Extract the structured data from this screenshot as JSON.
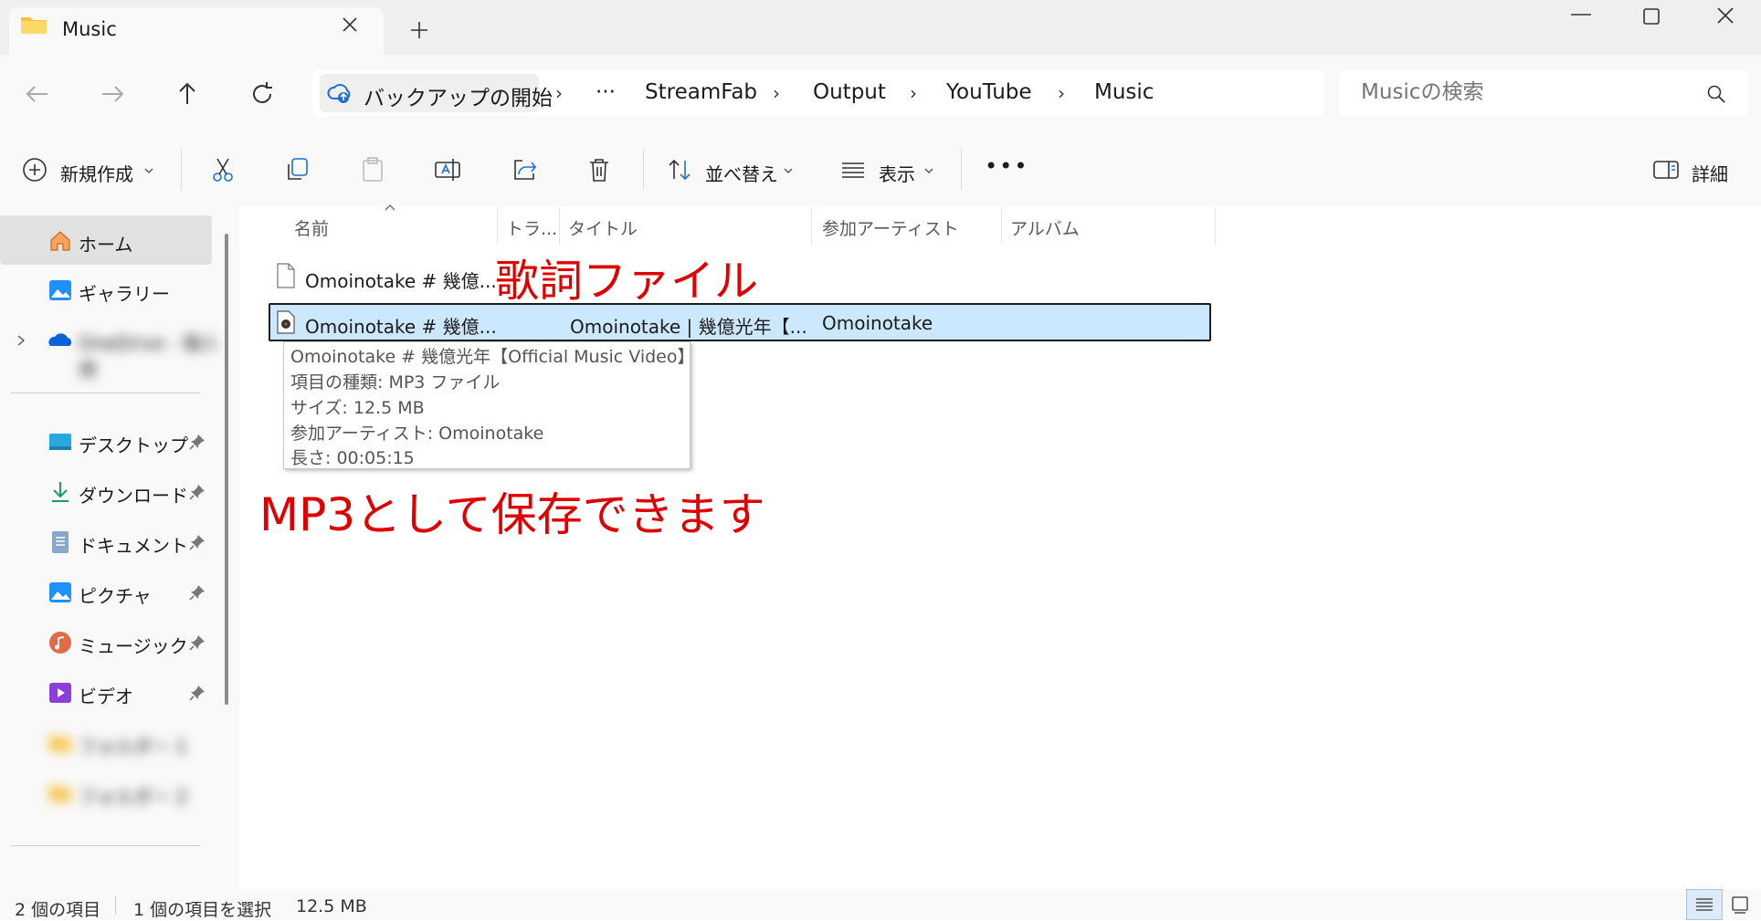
{
  "window": {
    "tab_title": "Music"
  },
  "address": {
    "backup_label": "バックアップの開始",
    "more": "···",
    "crumbs": [
      "StreamFab",
      "Output",
      "YouTube",
      "Music"
    ],
    "separator": "›"
  },
  "search": {
    "placeholder": "Musicの検索"
  },
  "toolbar": {
    "new_label": "新規作成",
    "sort_label": "並べ替え",
    "view_label": "表示",
    "more_label": "•••",
    "details_label": "詳細"
  },
  "sidebar": {
    "home": "ホーム",
    "gallery": "ギャラリー",
    "onedrive": "OneDrive - 個人用",
    "quick": [
      {
        "label": "デスクトップ",
        "icon": "desktop-icon"
      },
      {
        "label": "ダウンロード",
        "icon": "download-icon"
      },
      {
        "label": "ドキュメント",
        "icon": "documents-icon"
      },
      {
        "label": "ピクチャ",
        "icon": "pictures-icon"
      },
      {
        "label": "ミュージック",
        "icon": "music-icon"
      },
      {
        "label": "ビデオ",
        "icon": "videos-icon"
      }
    ],
    "blurred": [
      "フォルダー 1",
      "フォルダー 2"
    ]
  },
  "columns": [
    "名前",
    "トラ...",
    "タイトル",
    "参加アーティスト",
    "アルバム"
  ],
  "files": [
    {
      "name": "Omoinotake # 幾億...",
      "track": "",
      "title": "",
      "artist": "",
      "album": ""
    },
    {
      "name": "Omoinotake # 幾億...",
      "track": "",
      "title": "Omoinotake | 幾億光年【...",
      "artist": "Omoinotake",
      "album": ""
    }
  ],
  "tooltip": {
    "lines": [
      "Omoinotake # 幾億光年【Official Music Video】",
      "項目の種類: MP3 ファイル",
      "サイズ: 12.5 MB",
      "参加アーティスト: Omoinotake",
      "長さ: 00:05:15"
    ]
  },
  "annotations": {
    "lyrics": "歌詞ファイル",
    "mp3": "MP3として保存できます",
    "color": "#e00000"
  },
  "status": {
    "count": "2 個の項目",
    "selected": "1 個の項目を選択",
    "size": "12.5 MB"
  },
  "colors": {
    "selection": "#cce8ff",
    "accent": "#0067c0"
  }
}
